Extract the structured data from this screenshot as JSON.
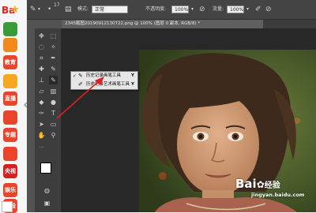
{
  "browser_sidebar": {
    "logo_text": "Ba",
    "favs": [
      {
        "label": "",
        "color": "#3a9b3a"
      },
      {
        "label": "",
        "color": "#f08a1c"
      },
      {
        "label": "教育",
        "color": "#e8452c"
      },
      {
        "label": "",
        "color": "#f5a623"
      },
      {
        "label": "直播",
        "color": "#e8452c"
      },
      {
        "label": "",
        "color": "#e8452c"
      },
      {
        "label": "专题",
        "color": "#e8452c"
      },
      {
        "label": "",
        "color": "#e8452c"
      },
      {
        "label": "央视",
        "color": "#d42020"
      },
      {
        "label": "娱乐",
        "color": "#e8452c"
      },
      {
        "label": "炒股",
        "color": "#e8452c"
      },
      {
        "label": "",
        "color": "#3a7be0"
      }
    ]
  },
  "options_bar": {
    "mode_label": "模式:",
    "mode_value": "正常",
    "opacity_label": "不透明度:",
    "opacity_value": "100%",
    "flow_label": "流量:",
    "flow_value": "100%",
    "brush_size": "17"
  },
  "document_tab": {
    "title": "2345截图20190912130722.png @ 100% (图层 0 副本, RGB/8) *"
  },
  "tool_flyout": {
    "items": [
      {
        "check": "✓",
        "label": "历史记录画笔工具",
        "shortcut": "Y"
      },
      {
        "check": "",
        "label": "历史记录艺术画笔工具",
        "shortcut": "Y"
      }
    ]
  },
  "watermark": {
    "brand": "Bai",
    "brand_suffix": "经验",
    "url": "jingyan.baidu.com"
  },
  "colors": {
    "ps_panel": "#535353",
    "options_bg": "#444444",
    "arrow_red": "#e02020"
  }
}
